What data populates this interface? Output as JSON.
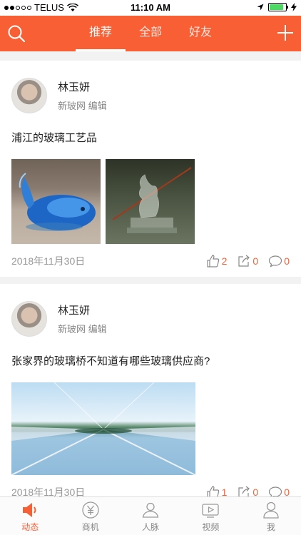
{
  "status_bar": {
    "carrier": "TELUS",
    "time": "11:10 AM",
    "battery_level": 0.85
  },
  "top_nav": {
    "tabs": [
      {
        "label": "推荐",
        "active": true
      },
      {
        "label": "全部",
        "active": false
      },
      {
        "label": "好友",
        "active": false
      }
    ]
  },
  "posts": [
    {
      "author": "林玉妍",
      "source": "新玻网",
      "role": "编辑",
      "title": "浦江的玻璃工艺品",
      "date": "2018年11月30日",
      "likes": "2",
      "shares": "0",
      "comments": "0"
    },
    {
      "author": "林玉妍",
      "source": "新玻网",
      "role": "编辑",
      "title": "张家界的玻璃桥不知道有哪些玻璃供应商?",
      "date": "2018年11月30日",
      "likes": "1",
      "shares": "0",
      "comments": "0"
    }
  ],
  "tab_bar": {
    "items": [
      {
        "label": "动态",
        "icon": "megaphone-icon",
        "active": true
      },
      {
        "label": "商机",
        "icon": "yen-coin-icon",
        "active": false
      },
      {
        "label": "人脉",
        "icon": "contacts-icon",
        "active": false
      },
      {
        "label": "视频",
        "icon": "video-icon",
        "active": false
      },
      {
        "label": "我",
        "icon": "person-icon",
        "active": false
      }
    ]
  },
  "colors": {
    "accent": "#f95f34",
    "background": "#f2f2f2"
  }
}
